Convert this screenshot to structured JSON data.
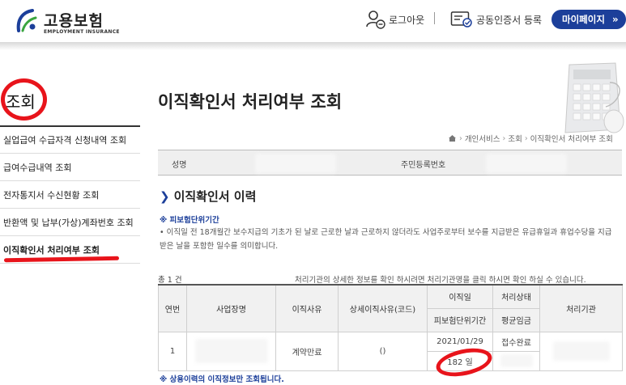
{
  "header": {
    "logo_title": "고용보험",
    "logo_sub": "EMPLOYMENT INSURANCE",
    "logout_label": "로그아웃",
    "cert_label": "공동인증서 등록",
    "mypage_label": "마이페이지",
    "mypage_chevron": "»"
  },
  "sidebar": {
    "title": "조회",
    "items": [
      {
        "label": "실업급여 수급자격 신청내역 조회"
      },
      {
        "label": "급여수급내역 조회"
      },
      {
        "label": "전자통지서 수신현황 조회"
      },
      {
        "label": "반환액 및 납부(가상)계좌번호 조회"
      },
      {
        "label": "이직확인서 처리여부 조회"
      }
    ]
  },
  "main": {
    "title": "이직확인서 처리여부 조회",
    "breadcrumb": [
      "개인서비스",
      "조회",
      "이직확인서 처리여부 조회"
    ],
    "info": {
      "name_label": "성명",
      "rrn_label": "주민등록번호"
    },
    "section_title": "이직확인서 이력",
    "note_head": "※ 피보험단위기간",
    "note_text": "• 이직일 전 18개월간 보수지급의 기초가 된 날로 근로한 날과 근로하지 않더라도 사업주로부터 보수를 지급받은 유급휴일과 휴업수당을 지급받은 날을 포함한 일수를 의미합니다.",
    "count": "총 1 건",
    "guide": "처리기관의 상세한 정보를 확인 하시려면 처리기관명을 클릭 하시면 확인 하실 수 있습니다.",
    "table": {
      "headers": {
        "no": "연번",
        "company": "사업장명",
        "reason": "이직사유",
        "detail_reason": "상세이직사유(코드)",
        "leave_date": "이직일",
        "period": "피보험단위기간",
        "status": "처리상태",
        "avg_wage": "평균임금",
        "agency": "처리기관"
      },
      "rows": [
        {
          "no": "1",
          "company": "",
          "reason": "계약만료",
          "detail_reason": "()",
          "leave_date": "2021/01/29",
          "period": "182 일",
          "status": "접수완료",
          "avg_wage": "",
          "agency": ""
        }
      ]
    },
    "foot_note": "※ 상용이력의 이직정보만 조회됩니다."
  },
  "colors": {
    "brand_navy": "#1c3f9a",
    "annotation_red": "#e8141b"
  },
  "icons": [
    "logo-icon",
    "logout-icon",
    "certificate-icon",
    "home-icon",
    "section-arrow-icon",
    "calculator-illustration"
  ]
}
